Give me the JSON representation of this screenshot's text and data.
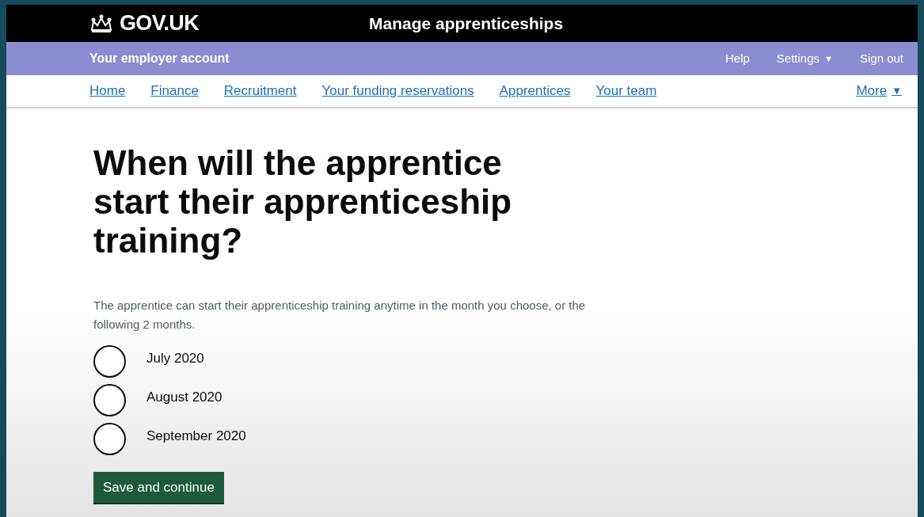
{
  "header": {
    "logo": "GOV.UK",
    "service": "Manage apprenticeships"
  },
  "account_bar": {
    "title": "Your employer account",
    "links": [
      {
        "label": "Help"
      },
      {
        "label": "Settings",
        "caret": "▼"
      },
      {
        "label": "Sign out"
      }
    ]
  },
  "nav": {
    "links": [
      "Home",
      "Finance",
      "Recruitment",
      "Your funding reservations",
      "Apprentices",
      "Your team"
    ],
    "more": {
      "label": "More",
      "caret": "▼"
    }
  },
  "heading": "When will the apprentice start their apprenticeship training?",
  "hint": "The apprentice can start their apprenticeship training anytime in the month you choose, or the following 2 months.",
  "options": [
    {
      "label": "July 2020",
      "selected": false
    },
    {
      "label": "August 2020",
      "selected": false
    },
    {
      "label": "September 2020",
      "selected": false
    }
  ],
  "button": "Save and continue"
}
